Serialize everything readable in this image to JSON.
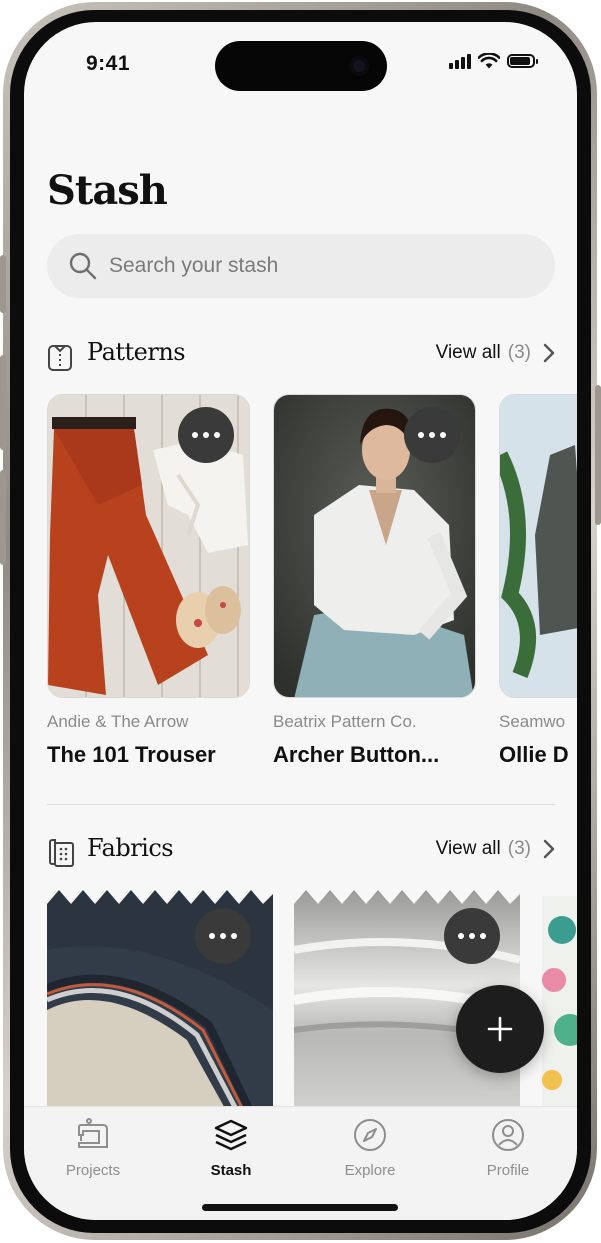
{
  "status_bar": {
    "time": "9:41"
  },
  "page": {
    "title": "Stash"
  },
  "search": {
    "placeholder": "Search your stash"
  },
  "patterns_section": {
    "title": "Patterns",
    "view_all_label": "View all",
    "count": "(3)",
    "items": [
      {
        "brand": "Andie & The Arrow",
        "name": "The 101 Trouser"
      },
      {
        "brand": "Beatrix Pattern Co.",
        "name": "Archer Button..."
      },
      {
        "brand": "Seamwo",
        "name": "Ollie D"
      }
    ]
  },
  "fabrics_section": {
    "title": "Fabrics",
    "view_all_label": "View all",
    "count": "(3)"
  },
  "tab_bar": {
    "items": [
      {
        "label": "Projects",
        "icon": "sewing-machine-icon"
      },
      {
        "label": "Stash",
        "icon": "stack-icon",
        "active": true
      },
      {
        "label": "Explore",
        "icon": "compass-icon"
      },
      {
        "label": "Profile",
        "icon": "user-circle-icon"
      }
    ]
  },
  "colors": {
    "accent": "#1d1d1d",
    "background": "#f7f7f7",
    "muted_text": "#8a8a8a"
  }
}
